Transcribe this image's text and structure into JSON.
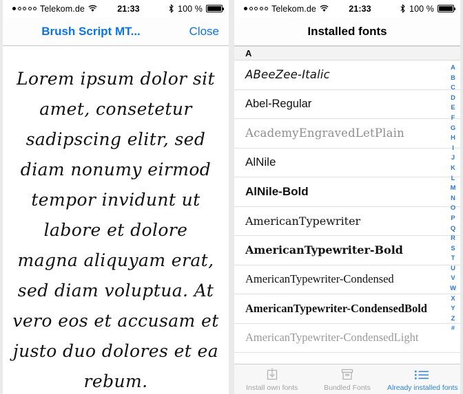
{
  "status_bar": {
    "signal_dots_filled": 1,
    "signal_dots_total": 5,
    "carrier": "Telekom.de",
    "wifi_icon": "wifi-icon",
    "time": "21:33",
    "bluetooth_icon": "bluetooth-icon",
    "battery_percent": "100 %",
    "battery_icon": "battery-full-icon"
  },
  "colors": {
    "tint": "#0a74e8",
    "index_blue": "#2b77d4",
    "tab_inactive": "#a3a3a3",
    "tab_active": "#2b84e0",
    "section_header_bg": "#f3f3f3",
    "separator": "#e2e2e2"
  },
  "left_screen": {
    "nav": {
      "title": "Brush Script MT...",
      "close_label": "Close"
    },
    "preview_text": "Lorem ipsum dolor sit amet, consetetur sadipscing elitr, sed diam nonumy eirmod tempor invidunt ut labore et dolore magna aliquyam erat, sed diam voluptua. At vero eos et accusam et justo duo dolores et ea rebum."
  },
  "right_screen": {
    "nav": {
      "title": "Installed fonts"
    },
    "section": {
      "letter": "A"
    },
    "fonts": [
      {
        "name": "ABeeZee-Italic",
        "style": "f-abeezee"
      },
      {
        "name": "Abel-Regular",
        "style": "f-abel"
      },
      {
        "name": "AcademyEngravedLetPlain",
        "style": "f-academy"
      },
      {
        "name": "AlNile",
        "style": "f-alnile"
      },
      {
        "name": "AlNile-Bold",
        "style": "f-alnileb"
      },
      {
        "name": "AmericanTypewriter",
        "style": "f-amtw"
      },
      {
        "name": "AmericanTypewriter-Bold",
        "style": "f-amtwb"
      },
      {
        "name": "AmericanTypewriter-Condensed",
        "style": "f-amtwc"
      },
      {
        "name": "AmericanTypewriter-CondensedBold",
        "style": "f-amtwcb"
      },
      {
        "name": "AmericanTypewriter-CondensedLight",
        "style": "f-amtwcl"
      }
    ],
    "index": [
      "A",
      "B",
      "C",
      "D",
      "E",
      "F",
      "G",
      "H",
      "I",
      "J",
      "K",
      "L",
      "M",
      "N",
      "O",
      "P",
      "Q",
      "R",
      "S",
      "T",
      "U",
      "V",
      "W",
      "X",
      "Y",
      "Z",
      "#"
    ],
    "tabs": [
      {
        "label": "Install own fonts",
        "icon": "download-box-icon",
        "active": false
      },
      {
        "label": "Bundled Fonts",
        "icon": "archive-box-icon",
        "active": false
      },
      {
        "label": "Already installed fonts",
        "icon": "bullet-list-icon",
        "active": true
      }
    ]
  }
}
